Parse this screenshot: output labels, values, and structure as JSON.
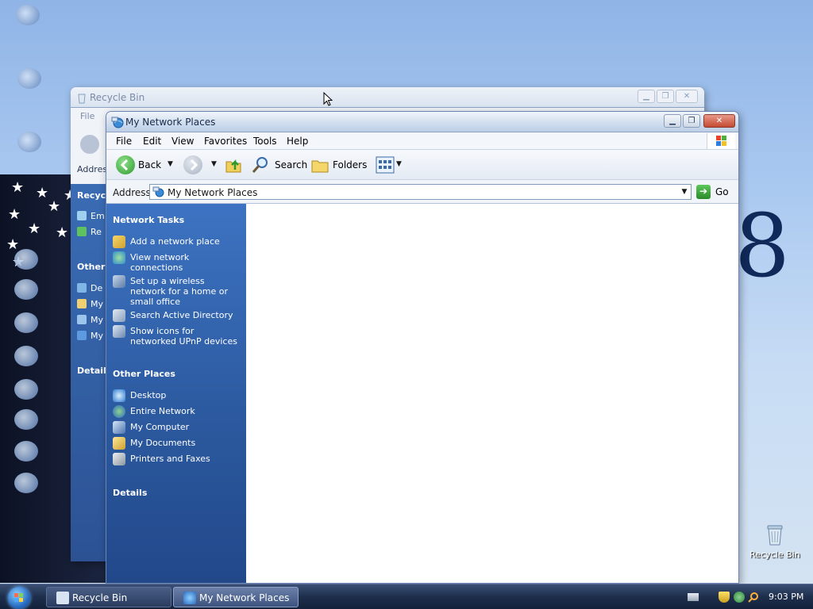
{
  "desktop": {
    "recycle_bin_icon": {
      "label": "Recycle Bin",
      "icon": "recycle-bin-icon"
    }
  },
  "recycle_window": {
    "title": "Recycle Bin",
    "menu_file": "File",
    "address_label": "Addres",
    "pane_heading_tasks": "Recycle",
    "pane_items_tasks": [
      "Em",
      "Re"
    ],
    "pane_heading_places": "Other I",
    "pane_items_places": [
      "De",
      "My",
      "My",
      "My"
    ],
    "pane_heading_details": "Details"
  },
  "window": {
    "title": "My Network Places",
    "icon": "network-places-icon"
  },
  "menu": {
    "file": "File",
    "edit": "Edit",
    "view": "View",
    "favorites": "Favorites",
    "tools": "Tools",
    "help": "Help"
  },
  "toolbar": {
    "back": "Back",
    "search": "Search",
    "folders": "Folders"
  },
  "address": {
    "label": "Address",
    "value": "My Network Places",
    "go": "Go"
  },
  "network_tasks": {
    "title": "Network Tasks",
    "items": [
      {
        "label": "Add a network place",
        "icon": "add-network-place-icon"
      },
      {
        "label": "View network connections",
        "icon": "network-connections-icon"
      },
      {
        "label": "Set up a wireless network for a home or small office",
        "icon": "wireless-network-icon"
      },
      {
        "label": "Search Active Directory",
        "icon": "search-directory-icon"
      },
      {
        "label": "Show icons for networked UPnP devices",
        "icon": "upnp-devices-icon"
      }
    ]
  },
  "other_places": {
    "title": "Other Places",
    "items": [
      {
        "label": "Desktop",
        "icon": "desktop-icon"
      },
      {
        "label": "Entire Network",
        "icon": "entire-network-icon"
      },
      {
        "label": "My Computer",
        "icon": "my-computer-icon"
      },
      {
        "label": "My Documents",
        "icon": "my-documents-icon"
      },
      {
        "label": "Printers and Faxes",
        "icon": "printers-icon"
      }
    ]
  },
  "details": {
    "title": "Details"
  },
  "taskbar": {
    "buttons": [
      {
        "label": "Recycle Bin",
        "active": false
      },
      {
        "label": "My Network Places",
        "active": true
      }
    ],
    "clock": "9:03 PM"
  },
  "colors": {
    "task_pane_top": "#3d73c2",
    "task_pane_bottom": "#22488a",
    "taskbar": "#1e2f4d",
    "close_button": "#c44a32"
  }
}
